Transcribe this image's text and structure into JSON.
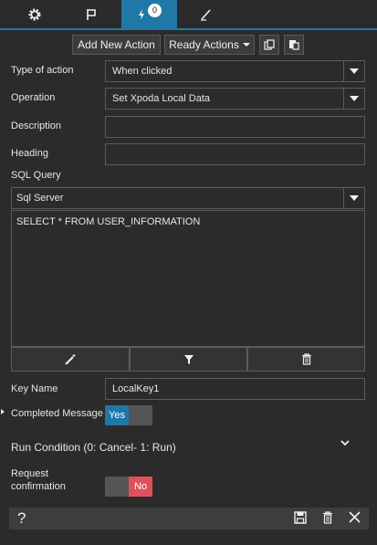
{
  "tabs": {
    "badge": "0"
  },
  "toolbar": {
    "add_new_action": "Add New Action",
    "ready_actions": "Ready Actions"
  },
  "form": {
    "type_of_action_label": "Type of action",
    "type_of_action_value": "When clicked",
    "operation_label": "Operation",
    "operation_value": "Set Xpoda Local Data",
    "description_label": "Description",
    "description_value": "",
    "heading_label": "Heading",
    "heading_value": "",
    "sql_query_label": "SQL Query",
    "sql_db_value": "Sql Server",
    "sql_text": "SELECT * FROM USER_INFORMATION",
    "key_name_label": "Key Name",
    "key_name_value": "LocalKey1",
    "completed_message_label": "Completed Message",
    "completed_message_toggle": "Yes",
    "run_condition_label": "Run Condition (0: Cancel- 1: Run)",
    "request_confirmation_label_1": "Request",
    "request_confirmation_label_2": "confirmation",
    "request_confirmation_toggle": "No"
  },
  "footer": {
    "help_label": "?"
  },
  "colors": {
    "accent": "#1f78a6",
    "yes": "#1f78a6",
    "no": "#e0505a"
  }
}
